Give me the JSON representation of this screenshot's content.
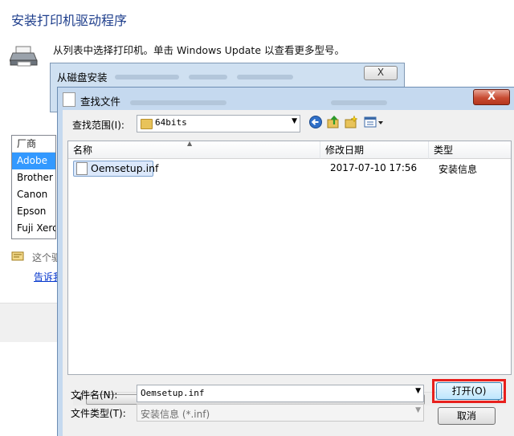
{
  "wizard": {
    "title": "安装打印机驱动程序",
    "description": "从列表中选择打印机。单击 Windows Update 以查看更多型号。",
    "vendor_header": "厂商",
    "vendors": [
      "Adobe",
      "Brother",
      "Canon",
      "Epson",
      "Fuji Xerox"
    ],
    "selected_vendor_index": 0,
    "signed_text": "这个驱",
    "help_link": "告诉我"
  },
  "disk_dialog": {
    "title": "从磁盘安装",
    "close_label": "X"
  },
  "find_dialog": {
    "title": "查找文件",
    "close_label": "X",
    "look_in_label": "查找范围(I):",
    "look_in_value": "64bits",
    "columns": [
      "名称",
      "修改日期",
      "类型"
    ],
    "files": [
      {
        "name": "Oemsetup.inf",
        "modified": "2017-07-10 17:56",
        "type": "安装信息"
      }
    ],
    "filename_label": "文件名(N):",
    "filename_value": "Oemsetup.inf",
    "filetype_label": "文件类型(T):",
    "filetype_value": "安装信息 (*.inf)",
    "open_label": "打开(O)",
    "cancel_label": "取消"
  },
  "colors": {
    "highlight": "#e8201d",
    "title_blue": "#1e3e8c",
    "selection": "#3399ff"
  }
}
